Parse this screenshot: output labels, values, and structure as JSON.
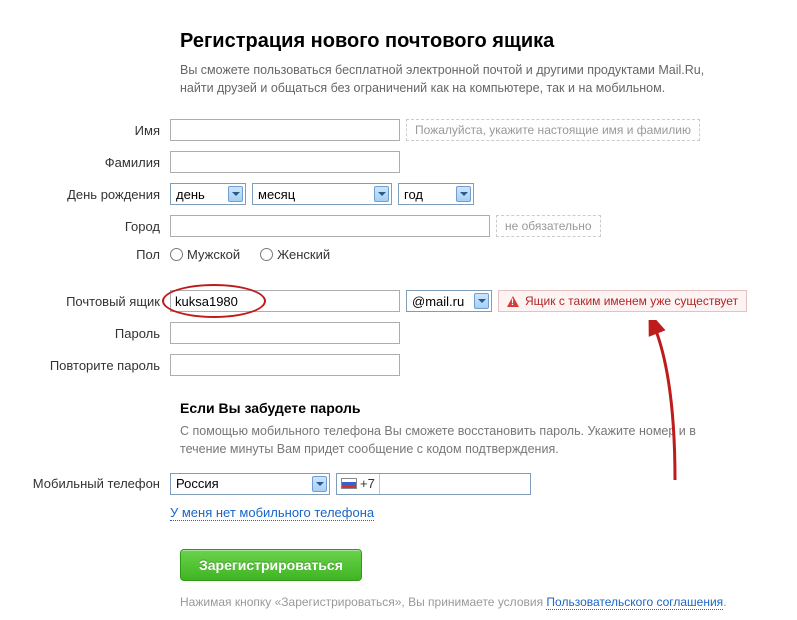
{
  "header": {
    "title": "Регистрация нового почтового ящика",
    "subtitle": "Вы сможете пользоваться бесплатной электронной почтой и другими продуктами Mail.Ru, найти друзей и общаться без ограничений как на компьютере, так и на мобильном."
  },
  "labels": {
    "firstname": "Имя",
    "lastname": "Фамилия",
    "birthday": "День рождения",
    "city": "Город",
    "sex": "Пол",
    "mailbox": "Почтовый ящик",
    "password": "Пароль",
    "password2": "Повторите пароль",
    "mobile": "Мобильный телефон"
  },
  "hints": {
    "name": "Пожалуйста, укажите настоящие имя и фамилию",
    "city": "не обязательно"
  },
  "birthday": {
    "day": "день",
    "month": "месяц",
    "year": "год"
  },
  "sex": {
    "male": "Мужской",
    "female": "Женский"
  },
  "mailbox": {
    "login": "kuksa1980",
    "domain": "@mail.ru",
    "error": "Ящик с таким именем уже существует"
  },
  "recovery": {
    "heading": "Если Вы забудете пароль",
    "desc": "С помощью мобильного телефона Вы сможете восстановить пароль. Укажите номер и в течение минуты Вам придет сообщение с кодом подтверждения.",
    "country": "Россия",
    "prefix": "+7",
    "no_mobile": "У меня нет мобильного телефона"
  },
  "submit": {
    "button": "Зарегистрироваться",
    "agree_prefix": "Нажимая кнопку «Зарегистрироваться», Вы принимаете условия ",
    "agree_link": "Пользовательского соглашения"
  }
}
